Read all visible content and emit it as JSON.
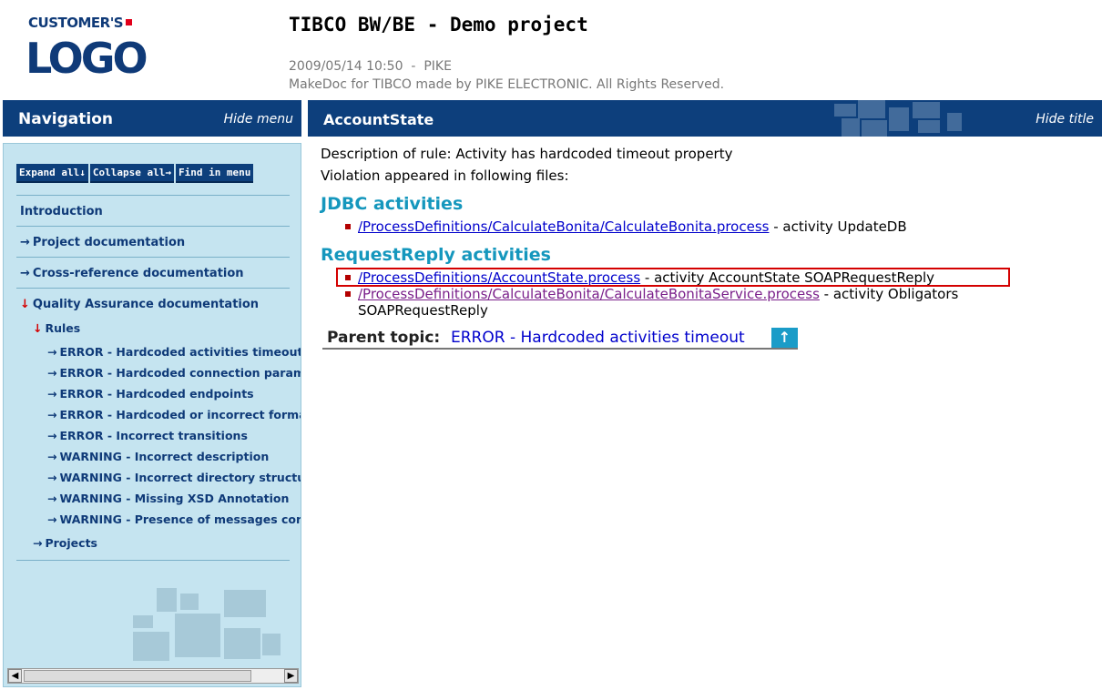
{
  "header": {
    "logo_top": "CUSTOMER'S",
    "logo_main": "LOGO",
    "title": "TIBCO BW/BE - Demo project",
    "meta_line1": "2009/05/14 10:50  -  PIKE",
    "meta_line2": "MakeDoc for TIBCO made by PIKE ELECTRONIC. All Rights Reserved."
  },
  "nav": {
    "title": "Navigation",
    "hide_label": "Hide menu",
    "buttons": {
      "expand": "Expand all↓",
      "collapse": "Collapse all→",
      "find": "Find in menu"
    },
    "items": {
      "introduction": "Introduction",
      "project_doc": "Project documentation",
      "xref_doc": "Cross-reference documentation",
      "qa_doc": "Quality Assurance documentation",
      "rules": "Rules",
      "projects": "Projects"
    },
    "rules": [
      "ERROR - Hardcoded activities timeout",
      "ERROR - Hardcoded connection paramet",
      "ERROR - Hardcoded endpoints",
      "ERROR - Hardcoded or incorrect format",
      "ERROR - Incorrect transitions",
      "WARNING - Incorrect description",
      "WARNING - Incorrect directory structure",
      "WARNING - Missing XSD Annotation",
      "WARNING - Presence of messages confir"
    ],
    "arrow_right": "→",
    "arrow_down": "↓",
    "scroll_left": "◀",
    "scroll_right": "▶"
  },
  "content": {
    "title": "AccountState",
    "hide_label": "Hide title",
    "description": "Description of rule: Activity has hardcoded timeout property",
    "violation": "Violation appeared in following files:",
    "jdbc_heading": "JDBC activities",
    "jdbc_link": "/ProcessDefinitions/CalculateBonita/CalculateBonita.process",
    "jdbc_suffix": " - activity UpdateDB",
    "rr_heading": "RequestReply activities",
    "rr1_link": "/ProcessDefinitions/AccountState.process",
    "rr1_suffix": " - activity AccountState SOAPRequestReply",
    "rr2_link": "/ProcessDefinitions/CalculateBonita/CalculateBonitaService.process",
    "rr2_suffix": " - activity Obligators",
    "rr2_cont": "SOAPRequestReply",
    "parent_label": "Parent topic:",
    "parent_link": "ERROR - Hardcoded activities timeout",
    "up_glyph": "↑"
  },
  "colors": {
    "bar_blue": "#0d3f7c",
    "nav_bg": "#c5e4f0",
    "heading_teal": "#1597bd",
    "link_blue": "#0000cc",
    "link_visited": "#7a1f8a",
    "highlight_red": "#d40000"
  }
}
